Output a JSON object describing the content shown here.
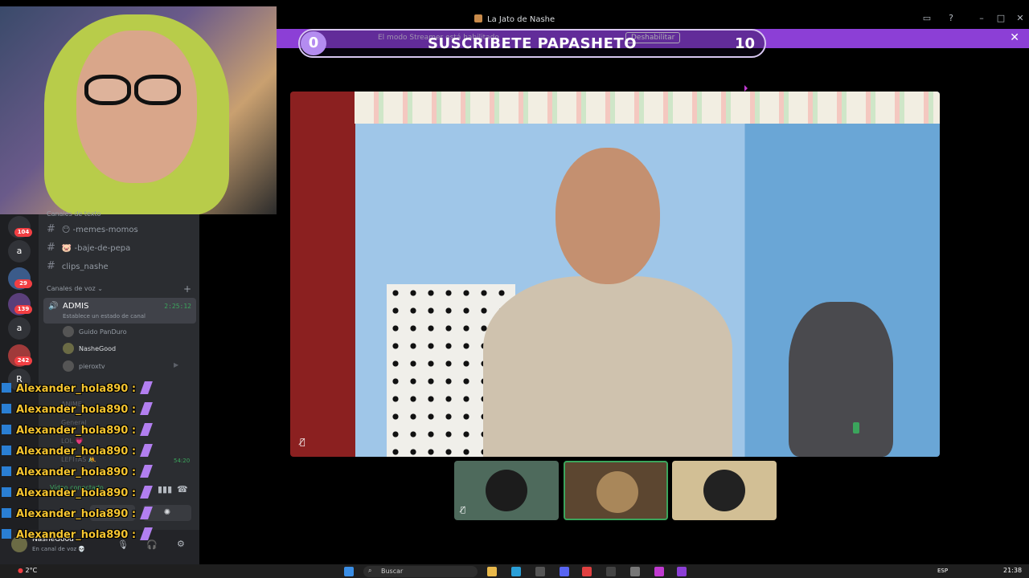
{
  "window": {
    "title": "La Jato de Nashe"
  },
  "streamer_mode": {
    "message": "El modo Streamer está habilitado",
    "disable_label": "Deshabilitar"
  },
  "sub_goal": {
    "current": "0",
    "title": "SUSCRIBETE PAPASHETO",
    "goal": "10"
  },
  "servers": [
    {
      "label": "",
      "badge": "104"
    },
    {
      "label": "a",
      "badge": ""
    },
    {
      "label": "",
      "badge": "29"
    },
    {
      "label": "",
      "badge": "139"
    },
    {
      "label": "a",
      "badge": ""
    },
    {
      "label": "",
      "badge": "242"
    },
    {
      "label": "R",
      "badge": ""
    }
  ],
  "sidebar": {
    "text_category": "Canales de texto",
    "text_channels": [
      "😶 -memes-momos",
      "🐷 -baje-de-pepa",
      "clips_nashe"
    ],
    "voice_category": "Canales de voz",
    "active_voice": {
      "name": "ADMIS",
      "timer": "2:25:12",
      "status": "Establece un estado de canal"
    },
    "voice_users": [
      "Guido PanDuro",
      "NasheGood",
      "pieroxtv"
    ],
    "ghost_channels": [
      "ANIME",
      "General",
      "LOL 💗",
      "LEFITAS 🤼"
    ],
    "timer2": "54:20",
    "voice_connected": "Vídeo conectado"
  },
  "user_panel": {
    "name": "NasheGood",
    "status": "En canal de voz 💀"
  },
  "chat": {
    "lines": [
      "Alexander_hola890 :",
      "Alexander_hola890 :",
      "Alexander_hola890 :",
      "Alexander_hola890 :",
      "Alexander_hola890 :",
      "Alexander_hola890 :",
      "Alexander_hola890 :",
      "Alexander_hola890 :"
    ]
  },
  "taskbar": {
    "weather": "2°C",
    "search_placeholder": "Buscar",
    "language": "ESP",
    "time": "21:38"
  },
  "colors": {
    "accent_purple": "#8c3fd6",
    "voice_green": "#3ba55c",
    "chat_yellow": "#f4c430"
  }
}
